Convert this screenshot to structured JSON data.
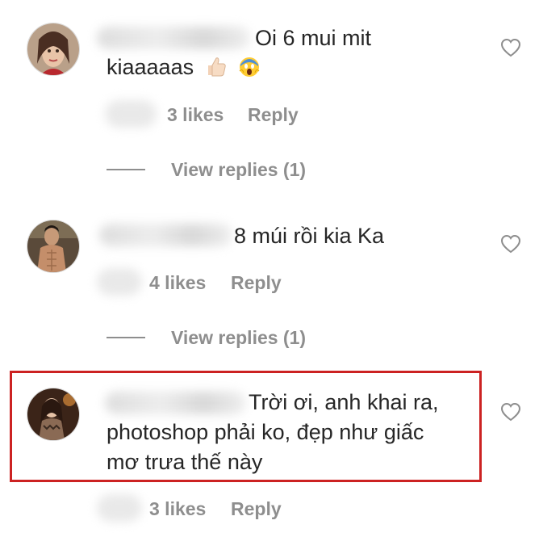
{
  "comments": [
    {
      "line1": "Oi 6 mui mit",
      "line2": "kiaaaaas",
      "emoji": [
        "thumbs-up-icon",
        "screaming-face-icon"
      ],
      "likes": "3 likes",
      "reply": "Reply",
      "view_replies": "View replies (1)"
    },
    {
      "line1": "8 múi rồi kia Ka",
      "likes": "4 likes",
      "reply": "Reply",
      "view_replies": "View replies (1)"
    },
    {
      "line1": "Trời ơi, anh khai ra,",
      "line2": "photoshop phải ko, đẹp như giấc",
      "line3": "mơ trưa thế này",
      "likes": "3 likes",
      "reply": "Reply",
      "highlighted": true
    }
  ],
  "colors": {
    "text": "#262626",
    "meta": "#8e8e8e",
    "highlight_border": "#cc2222"
  }
}
